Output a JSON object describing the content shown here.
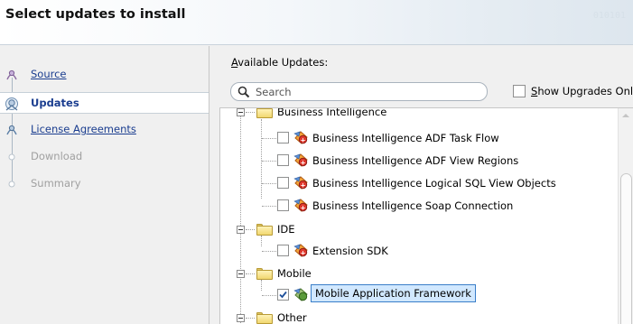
{
  "header": {
    "title": "Select updates to install",
    "decoration": "010101"
  },
  "sidebar": {
    "steps": [
      {
        "label": "Source",
        "state": "link",
        "icon": "train-stop-icon"
      },
      {
        "label": "Updates",
        "state": "current",
        "icon": "train-stop-current-icon"
      },
      {
        "label": "License Agreements",
        "state": "link",
        "icon": "train-stop-icon"
      },
      {
        "label": "Download",
        "state": "disabled",
        "icon": "train-stop-empty-icon"
      },
      {
        "label": "Summary",
        "state": "disabled",
        "icon": "train-stop-empty-icon"
      }
    ]
  },
  "main": {
    "available_label_prefix": "A",
    "available_label_rest": "vailable Updates:",
    "search_placeholder": "Search",
    "show_upgrades_prefix": "S",
    "show_upgrades_rest": "how Upgrades Only",
    "show_upgrades_checked": false
  },
  "tree": {
    "groups": [
      {
        "label": "Business Intelligence",
        "expanded": true,
        "children": [
          {
            "label": "Business Intelligence ADF Task Flow",
            "checked": false
          },
          {
            "label": "Business Intelligence ADF View Regions",
            "checked": false
          },
          {
            "label": "Business Intelligence Logical SQL View Objects",
            "checked": false
          },
          {
            "label": "Business Intelligence Soap Connection",
            "checked": false
          }
        ]
      },
      {
        "label": "IDE",
        "expanded": true,
        "children": [
          {
            "label": "Extension SDK",
            "checked": false
          }
        ]
      },
      {
        "label": "Mobile",
        "expanded": true,
        "children": [
          {
            "label": "Mobile Application Framework",
            "checked": true,
            "selected": true
          }
        ]
      },
      {
        "label": "Other",
        "expanded": true,
        "children": []
      }
    ]
  },
  "colors": {
    "link": "#1a3d8f",
    "selection_fill": "#d1e8ff",
    "selection_border": "#3a7ec8",
    "folder": "#f1d770"
  }
}
